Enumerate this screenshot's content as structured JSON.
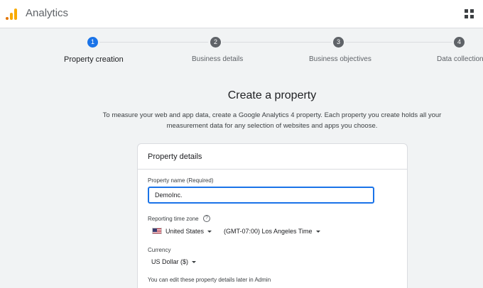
{
  "app": {
    "title": "Analytics"
  },
  "stepper": {
    "steps": [
      {
        "number": "1",
        "label": "Property creation"
      },
      {
        "number": "2",
        "label": "Business details"
      },
      {
        "number": "3",
        "label": "Business objectives"
      },
      {
        "number": "4",
        "label": "Data collection"
      }
    ],
    "active_step": 1
  },
  "main": {
    "heading": "Create a property",
    "description": "To measure your web and app data, create a Google Analytics 4 property. Each property you create holds all your measurement data for any selection of websites and apps you choose."
  },
  "card": {
    "title": "Property details",
    "property_name_label": "Property name (Required)",
    "property_name_value": "DemoInc.",
    "time_zone_label": "Reporting time zone",
    "help_glyph": "?",
    "country": "United States",
    "time_zone": "(GMT-07:00) Los Angeles Time",
    "currency_label": "Currency",
    "currency": "US Dollar ($)",
    "note": "You can edit these property details later in Admin"
  },
  "colors": {
    "accent": "#1a73e8",
    "logo_orange": "#f9ab00"
  },
  "icons": {
    "logo": "analytics-logo-icon",
    "apps": "apps-grid-icon",
    "help": "help-icon",
    "flag": "us-flag-icon"
  }
}
